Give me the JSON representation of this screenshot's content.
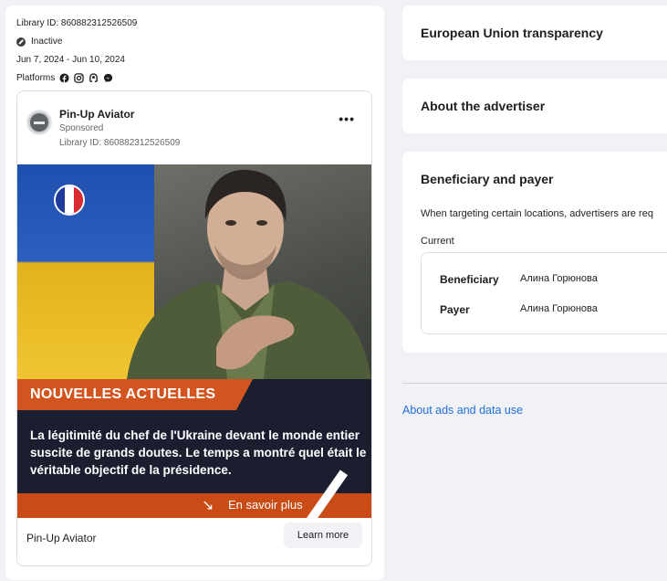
{
  "left": {
    "library_id": "Library ID: 860882312526509",
    "status": "Inactive",
    "dates": "Jun 7, 2024 - Jun 10, 2024",
    "platforms_label": "Platforms",
    "platform_icons": [
      "facebook-icon",
      "instagram-icon",
      "audience-network-icon",
      "messenger-icon"
    ]
  },
  "ad": {
    "advertiser": "Pin-Up Aviator",
    "sponsored": "Sponsored",
    "library_id": "Library ID: 860882312526509",
    "more": "•••",
    "creative": {
      "headline": "NOUVELLES ACTUELLES",
      "body": "La légitimité du chef de l'Ukraine devant le monde entier suscite de grands doutes. Le temps a montré quel était le véritable objectif de la présidence.",
      "cta_arrow": "↘",
      "cta": "En savoir plus"
    },
    "footer_name": "Pin-Up Aviator",
    "learn_more": "Learn more"
  },
  "right": {
    "eu_title": "European Union transparency",
    "about_title": "About the advertiser",
    "bene_title": "Beneficiary and payer",
    "bene_desc": "When targeting certain locations, advertisers are req",
    "current_label": "Current",
    "beneficiary_label": "Beneficiary",
    "beneficiary_value": "Алина Горюнова",
    "payer_label": "Payer",
    "payer_value": "Алина Горюнова"
  },
  "links": {
    "about_ads": "About ads and data use"
  },
  "colors": {
    "accent_link": "#216fdb",
    "cta_orange": "#d2541e",
    "creative_dark": "#1b1e2e"
  }
}
